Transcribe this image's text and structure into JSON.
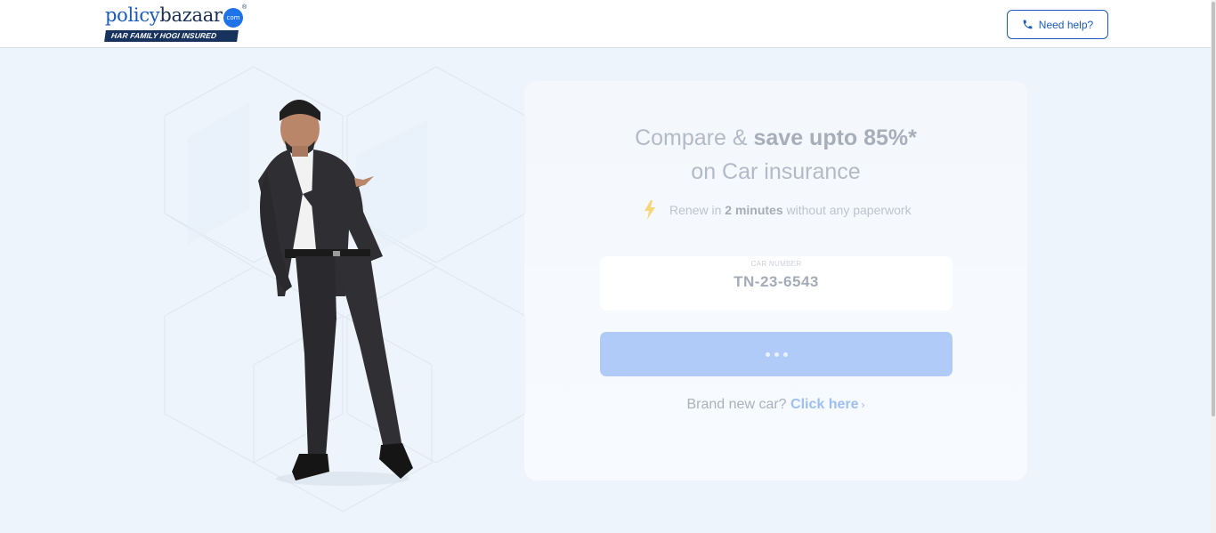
{
  "header": {
    "logo": {
      "word1": "policy",
      "word2": "bazaar",
      "com": "com",
      "reg": "®",
      "tagline": "HAR FAMILY HOGI INSURED"
    },
    "help_label": "Need help?"
  },
  "hero": {
    "headline_pre": "Compare & ",
    "headline_bold": "save upto 85%*",
    "headline_line2": "on Car insurance",
    "renew_pre": "Renew in ",
    "renew_bold": "2 minutes",
    "renew_post": " without any paperwork"
  },
  "form": {
    "car_label": "CAR NUMBER",
    "car_value": "TN-23-6543",
    "submit_state": "loading"
  },
  "footer_link": {
    "prefix": "Brand new car? ",
    "link": "Click here",
    "chevron": "›"
  },
  "icons": [
    "phone-icon",
    "lightning-bolt-icon",
    "chevron-right-icon"
  ],
  "colors": {
    "brand_blue": "#1a5bb8",
    "button_disabled": "#b0cbf7",
    "page_bg": "#eef4fc"
  }
}
